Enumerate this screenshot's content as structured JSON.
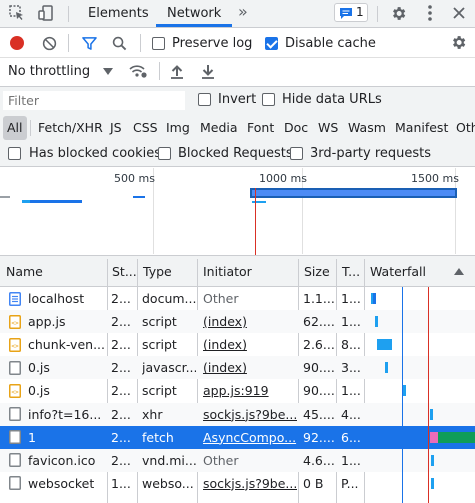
{
  "tabs": {
    "elements": "Elements",
    "network": "Network",
    "more": "»",
    "issues_count": "1"
  },
  "toolbar": {
    "preserve_log": "Preserve log",
    "disable_cache": "Disable cache",
    "throttling": "No throttling"
  },
  "filter": {
    "placeholder": "Filter",
    "invert": "Invert",
    "hide_data_urls": "Hide data URLs",
    "types": [
      "All",
      "Fetch/XHR",
      "JS",
      "CSS",
      "Img",
      "Media",
      "Font",
      "Doc",
      "WS",
      "Wasm",
      "Manifest",
      "Oth"
    ],
    "blocked_cookies": "Has blocked cookies",
    "blocked_requests": "Blocked Requests",
    "third_party": "3rd-party requests"
  },
  "overview": {
    "ticks": [
      "500 ms",
      "1000 ms",
      "1500 ms"
    ]
  },
  "table": {
    "headers": {
      "name": "Name",
      "status": "St...",
      "type": "Type",
      "initiator": "Initiator",
      "size": "Size",
      "time": "T...",
      "waterfall": "Waterfall"
    },
    "rows": [
      {
        "icon": "document-icon",
        "name": "localhost",
        "status": "2...",
        "type": "docum...",
        "initiator": "Other",
        "initiator_link": false,
        "size": "1.1...",
        "time": "1..."
      },
      {
        "icon": "script-icon",
        "name": "app.js",
        "status": "2...",
        "type": "script",
        "initiator": "(index)",
        "initiator_link": true,
        "size": "62....",
        "time": "1..."
      },
      {
        "icon": "script-icon",
        "name": "chunk-ven...",
        "status": "2...",
        "type": "script",
        "initiator": "(index)",
        "initiator_link": true,
        "size": "2.6...",
        "time": "8..."
      },
      {
        "icon": "file-icon",
        "name": "0.js",
        "status": "2...",
        "type": "javascr...",
        "initiator": "(index)",
        "initiator_link": true,
        "size": "90....",
        "time": "3..."
      },
      {
        "icon": "script-icon",
        "name": "0.js",
        "status": "2...",
        "type": "script",
        "initiator": "app.js:919",
        "initiator_link": true,
        "size": "90....",
        "time": "1..."
      },
      {
        "icon": "file-icon",
        "name": "info?t=16...",
        "status": "2...",
        "type": "xhr",
        "initiator": "sockjs.js?9be...",
        "initiator_link": true,
        "size": "45....",
        "time": "4..."
      },
      {
        "icon": "file-icon",
        "name": "1",
        "status": "2...",
        "type": "fetch",
        "initiator": "AsyncCompo...",
        "initiator_link": true,
        "size": "92....",
        "time": "6..."
      },
      {
        "icon": "file-icon",
        "name": "favicon.ico",
        "status": "2...",
        "type": "vnd.mi...",
        "initiator": "Other",
        "initiator_link": false,
        "size": "4.6...",
        "time": "1..."
      },
      {
        "icon": "file-icon",
        "name": "websocket",
        "status": "1...",
        "type": "webso...",
        "initiator": "sockjs.js?9be...",
        "initiator_link": true,
        "size": "0 B",
        "time": "P..."
      }
    ]
  },
  "colors": {
    "accent": "#1a73e8",
    "record": "#d93025",
    "selected_row": "#1a73e8",
    "waterfall_green": "#0f9d58",
    "waterfall_blue": "#1a73e8",
    "red_line": "#d93025"
  }
}
